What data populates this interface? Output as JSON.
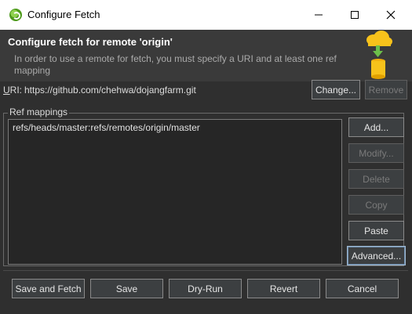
{
  "window": {
    "title": "Configure Fetch"
  },
  "header": {
    "title": "Configure fetch for remote 'origin'",
    "message": "In order to use a remote for fetch, you must specify a URI and at least one ref mapping"
  },
  "uri": {
    "label_prefix": "",
    "label_mnemonic": "U",
    "label_rest": "RI:",
    "value": "https://github.com/chehwa/dojangfarm.git",
    "change_label": "Change...",
    "remove_label": "Remove"
  },
  "ref_mappings": {
    "group_label": "Ref mappings",
    "items": [
      "refs/heads/master:refs/remotes/origin/master"
    ],
    "buttons": {
      "add": "Add...",
      "modify": "Modify...",
      "delete": "Delete",
      "copy": "Copy",
      "paste": "Paste",
      "advanced": "Advanced..."
    }
  },
  "footer": {
    "save_and_fetch": "Save and Fetch",
    "save": "Save",
    "dry_run": "Dry-Run",
    "revert": "Revert",
    "cancel": "Cancel"
  },
  "colors": {
    "background": "#2f2f2f",
    "header_bg": "#3a3a3a",
    "list_bg": "#262626",
    "accent_cloud": "#f7c21b",
    "accent_arrow": "#6cc04a"
  },
  "icons": [
    "app-icon",
    "minimize-icon",
    "maximize-icon",
    "close-icon",
    "cloud-fetch-icon"
  ]
}
